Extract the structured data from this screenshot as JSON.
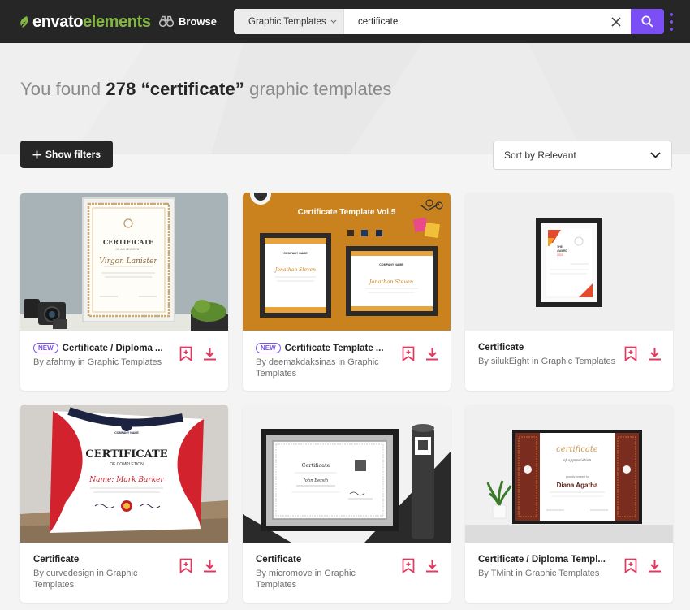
{
  "nav": {
    "logo_part1": "envato",
    "logo_part2": "elements",
    "browse_label": "Browse",
    "category_value": "Graphic Templates",
    "search_value": "certificate",
    "accent": "#7b4ff5",
    "brand_green": "#82b541"
  },
  "hero": {
    "prefix": "You found ",
    "count": "278",
    "query": "“certificate”",
    "suffix": " graphic templates"
  },
  "toolbar": {
    "filters_label": "Show filters",
    "sort_label": "Sort by Relevant"
  },
  "cards": [
    {
      "badge": "NEW",
      "title": "Certificate / Diploma ...",
      "by": "By ",
      "author": "afahmy",
      "in": " in ",
      "category": "Graphic Templates"
    },
    {
      "badge": "NEW",
      "title": "Certificate Template ...",
      "by": "By ",
      "author": "deemakdaksinas",
      "in": " in ",
      "category": "Graphic Templates"
    },
    {
      "badge": "",
      "title": "Certificate",
      "by": "By ",
      "author": "silukEight",
      "in": " in ",
      "category": "Graphic Templates"
    },
    {
      "badge": "",
      "title": "Certificate",
      "by": "By ",
      "author": "curvedesign",
      "in": " in ",
      "category": "Graphic Templates"
    },
    {
      "badge": "",
      "title": "Certificate",
      "by": "By ",
      "author": "micromove",
      "in": " in ",
      "category": "Graphic Templates"
    },
    {
      "badge": "",
      "title": "Certificate / Diploma Templ...",
      "by": "By ",
      "author": "TMint",
      "in": " in ",
      "category": "Graphic Templates"
    }
  ],
  "thumbs": {
    "t1": {
      "line1": "CERTIFICATE",
      "line2": "OF ACHIEVEMENT",
      "name": "Virgon Lanister"
    },
    "t2": {
      "heading": "Certificate Template Vol.5",
      "brand": "COMPANY NAME",
      "name": "Jonathan Steven"
    },
    "t3": {
      "line1": "THE",
      "line2": "AWARD",
      "line3": "2020"
    },
    "t4": {
      "brand": "COMPANY NAME",
      "line1": "CERTIFICATE",
      "line2": "OF COMPLETION",
      "name": "Name: Mark Barker"
    },
    "t5": {
      "line1": "Certificate",
      "name": "John Bersih"
    },
    "t6": {
      "line1": "certificate",
      "line2": "of appreciation",
      "pre": "proudly present to",
      "name": "Diana Agatha"
    }
  },
  "icons": [
    "bookmark-add-icon",
    "download-icon",
    "search-icon",
    "close-icon",
    "binoculars-icon",
    "chevron-down-icon",
    "plus-icon",
    "kebab-menu-icon"
  ]
}
